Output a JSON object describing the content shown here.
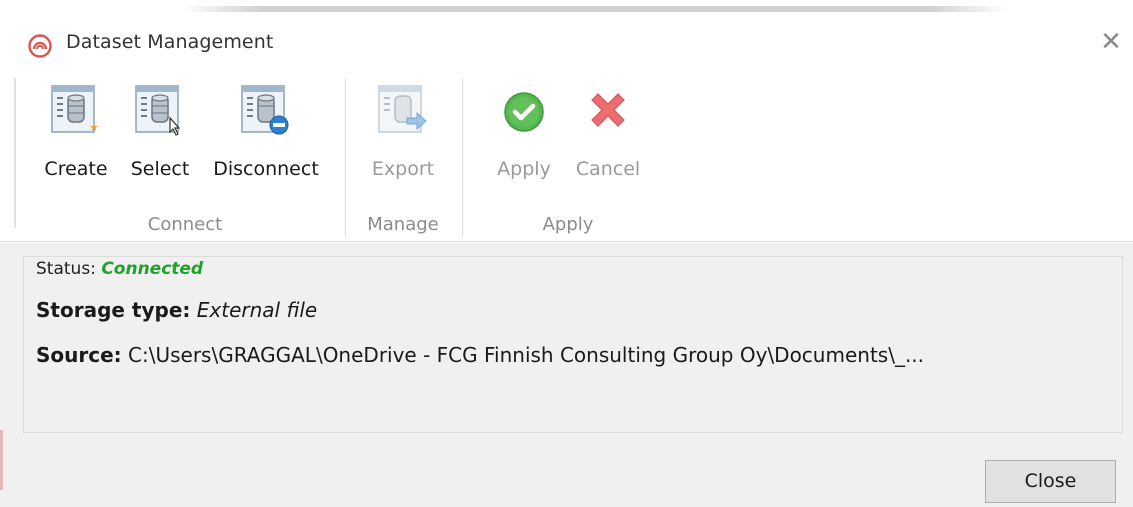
{
  "window": {
    "title": "Dataset Management",
    "close_glyph": "✕"
  },
  "ribbon": {
    "groups": [
      {
        "label": "Connect",
        "buttons": [
          {
            "label": "Create",
            "icon": "database-create-icon",
            "enabled": true
          },
          {
            "label": "Select",
            "icon": "database-select-icon",
            "enabled": true
          },
          {
            "label": "Disconnect",
            "icon": "database-disconnect-icon",
            "enabled": true
          }
        ]
      },
      {
        "label": "Manage",
        "buttons": [
          {
            "label": "Export",
            "icon": "database-export-icon",
            "enabled": false
          }
        ]
      },
      {
        "label": "Apply",
        "buttons": [
          {
            "label": "Apply",
            "icon": "green-check-icon",
            "enabled": false
          },
          {
            "label": "Cancel",
            "icon": "red-x-icon",
            "enabled": false
          }
        ]
      }
    ]
  },
  "details": {
    "status_label": "Status:",
    "status_value": "Connected",
    "storage_label": "Storage type:",
    "storage_value": "External file",
    "source_label": "Source:",
    "source_value": "C:\\Users\\GRAGGAL\\OneDrive - FCG Finnish Consulting Group Oy\\Documents\\_..."
  },
  "footer": {
    "close_label": "Close"
  },
  "colors": {
    "status_connected": "#22a12c",
    "apply_check": "#4cb848",
    "cancel_x": "#e8676a",
    "app_icon": "#d9534f"
  }
}
